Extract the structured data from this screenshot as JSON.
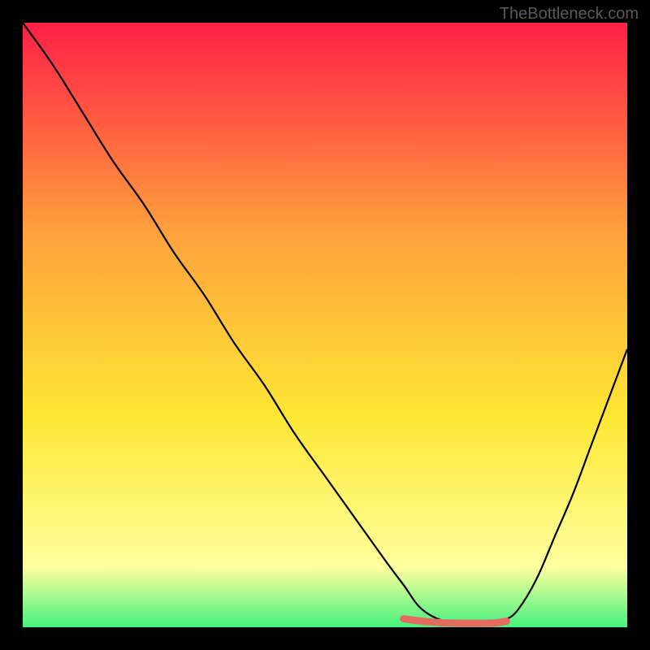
{
  "watermark": "TheBottleneck.com",
  "chart_data": {
    "type": "line",
    "title": "",
    "xlabel": "",
    "ylabel": "",
    "x_range": [
      0,
      100
    ],
    "y_range": [
      0,
      100
    ],
    "grid": false,
    "background_gradient": {
      "top": "#FF1F46",
      "mid1": "#FFA23C",
      "mid2": "#FDE733",
      "mid3": "#FFFF9E",
      "bottom": "#46F27E"
    },
    "series": [
      {
        "name": "curve",
        "color": "#000000",
        "width": 2.2,
        "x": [
          0,
          5,
          10,
          15,
          20,
          25,
          30,
          35,
          40,
          45,
          50,
          55,
          60,
          63,
          66,
          70,
          74,
          78,
          80,
          82,
          85,
          88,
          91,
          94,
          97,
          100
        ],
        "values": [
          100,
          93,
          85,
          77,
          70,
          62,
          55,
          47,
          40,
          32,
          25,
          18,
          11,
          7,
          3,
          0.9,
          0.6,
          0.7,
          1.3,
          3,
          8,
          15,
          22,
          30,
          38,
          46
        ]
      },
      {
        "name": "highlight",
        "color": "#E46A62",
        "width": 9,
        "cap": "round",
        "x": [
          63,
          66,
          70,
          74,
          78,
          80
        ],
        "values": [
          1.4,
          1.0,
          0.7,
          0.65,
          0.7,
          1.0
        ]
      }
    ]
  }
}
